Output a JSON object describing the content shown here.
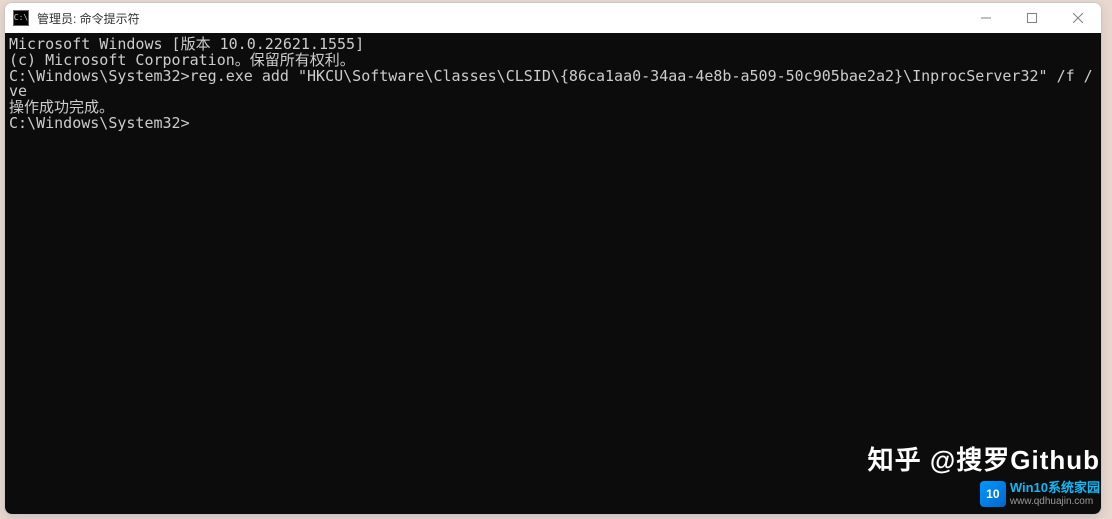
{
  "window": {
    "title": "管理员: 命令提示符",
    "icon_text": "C:\\"
  },
  "terminal": {
    "line1": "Microsoft Windows [版本 10.0.22621.1555]",
    "line2": "(c) Microsoft Corporation。保留所有权利。",
    "line3": "",
    "line4": "C:\\Windows\\System32>reg.exe add \"HKCU\\Software\\Classes\\CLSID\\{86ca1aa0-34aa-4e8b-a509-50c905bae2a2}\\InprocServer32\" /f /ve",
    "line5": "操作成功完成。",
    "line6": "",
    "line7": "C:\\Windows\\System32>"
  },
  "watermark": {
    "zhihu": "知乎 @搜罗Github",
    "qd_icon": "10",
    "qd_title": "Win10系统家园",
    "qd_url": "www.qdhuajin.com"
  }
}
